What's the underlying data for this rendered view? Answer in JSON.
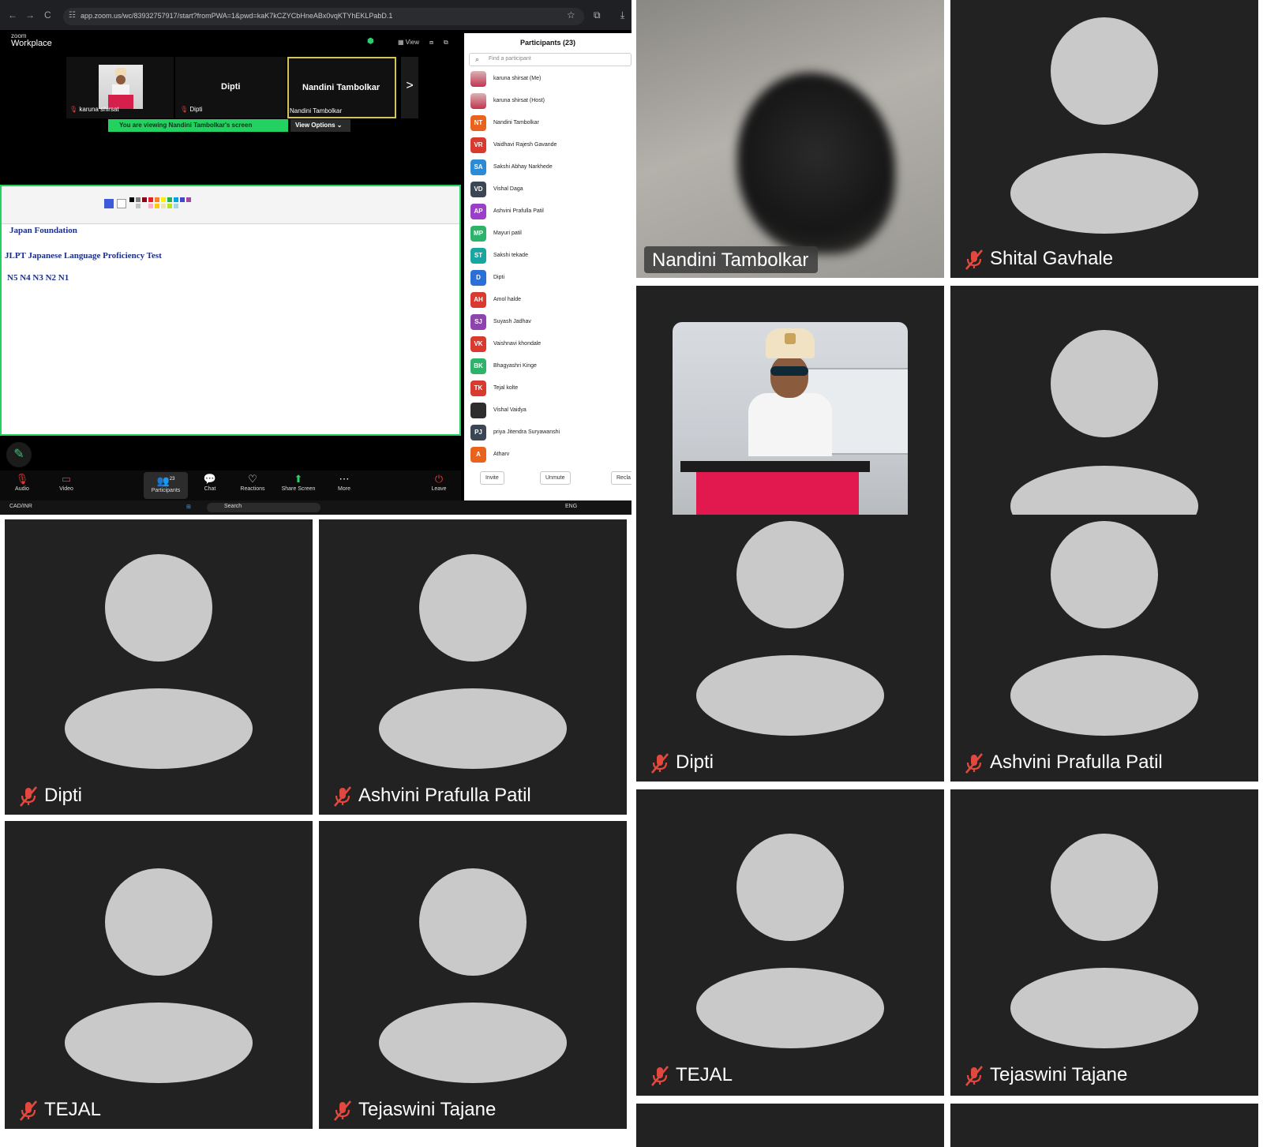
{
  "browser": {
    "url": "app.zoom.us/wc/83932757917/start?fromPWA=1&pwd=kaK7kCZYCbHneABx0vqKTYhEKLPabD.1",
    "back": "←",
    "forward": "→",
    "reload": "C"
  },
  "zoom": {
    "brand_small": "zoom",
    "brand_big": "Workplace",
    "view_label": "View",
    "strip": {
      "tile1_name": "karuna shirsat",
      "tile2_center": "Dipti",
      "tile2_name": "Dipti",
      "tile3_center": "Nandini Tambolkar",
      "tile3_name": "Nandini Tambolkar",
      "arrow": ">"
    },
    "viewing_bar": "You are viewing  Nandini Tambolkar's screen",
    "view_options": "View Options ⌄",
    "shared": {
      "line1": "Japan Foundation",
      "line2": "JLPT    Japanese Language Proficiency Test",
      "line3": "N5   N4    N3    N2    N1"
    },
    "toolbar": [
      {
        "label": "Audio",
        "icon": "mic-muted-icon"
      },
      {
        "label": "Video",
        "icon": "video-off-icon"
      },
      {
        "label": "Participants",
        "icon": "participants-icon",
        "badge": "23"
      },
      {
        "label": "Chat",
        "icon": "chat-icon"
      },
      {
        "label": "Reactions",
        "icon": "heart-icon"
      },
      {
        "label": "Share Screen",
        "icon": "share-icon"
      },
      {
        "label": "More",
        "icon": "more-icon"
      },
      {
        "label": "Leave",
        "icon": "leave-icon"
      }
    ],
    "taskbar": {
      "ticker": "CAD/INR",
      "search": "Search",
      "lang": "ENG"
    },
    "participants": {
      "title": "Participants (23)",
      "search_placeholder": "Find a participant",
      "list": [
        {
          "initials": "",
          "name": "karuna shirsat (Me)",
          "color": "photo"
        },
        {
          "initials": "",
          "name": "karuna shirsat (Host)",
          "color": "photo"
        },
        {
          "initials": "NT",
          "name": "Nandini Tambolkar",
          "color": "#e8641e"
        },
        {
          "initials": "VR",
          "name": "Vaidhavi Rajesh Gavande",
          "color": "#d93a2f"
        },
        {
          "initials": "SA",
          "name": "Sakshi Abhay Narkhede",
          "color": "#2c8bd6"
        },
        {
          "initials": "VD",
          "name": "Vishal Daga",
          "color": "#3b4654"
        },
        {
          "initials": "AP",
          "name": "Ashvini Prafulla Patil",
          "color": "#9b3fc9"
        },
        {
          "initials": "MP",
          "name": "Mayuri patil",
          "color": "#2fb36b"
        },
        {
          "initials": "ST",
          "name": "Sakshi tekade",
          "color": "#19a6a0"
        },
        {
          "initials": "D",
          "name": "Dipti",
          "color": "#2c6fd6"
        },
        {
          "initials": "AH",
          "name": "Amol halde",
          "color": "#d93a2f"
        },
        {
          "initials": "SJ",
          "name": "Suyash Jadhav",
          "color": "#8e44ad"
        },
        {
          "initials": "VK",
          "name": "Vaishnavi khondale",
          "color": "#d93a2f"
        },
        {
          "initials": "BK",
          "name": "Bhagyashri Kinge",
          "color": "#2fb36b"
        },
        {
          "initials": "TK",
          "name": "Tejal kolte",
          "color": "#d93a2f"
        },
        {
          "initials": "",
          "name": "Vishal Vaidya",
          "color": "dark"
        },
        {
          "initials": "PJ",
          "name": "priya Jitendra Suryawanshi",
          "color": "#3b4654"
        },
        {
          "initials": "A",
          "name": "Atharv",
          "color": "#e8641e"
        }
      ],
      "invite": "Invite",
      "unmute": "Unmute",
      "reclaim": "Recla"
    }
  },
  "gallery": {
    "left": [
      {
        "name": "Dipti"
      },
      {
        "name": "Ashvini Prafulla Patil"
      },
      {
        "name": "TEJAL"
      },
      {
        "name": "Tejaswini Tajane"
      }
    ],
    "right": [
      {
        "name": "Nandini Tambolkar"
      },
      {
        "name": "Shital Gavhale"
      },
      {
        "name": "Dipti"
      },
      {
        "name": "Ashvini Prafulla Patil"
      },
      {
        "name": "TEJAL"
      },
      {
        "name": "Tejaswini Tajane"
      }
    ]
  },
  "colors": {
    "tile_bg": "#222222",
    "avatar": "#c9c9c9",
    "mute_red": "#e2483d",
    "zoom_green": "#23d160"
  }
}
